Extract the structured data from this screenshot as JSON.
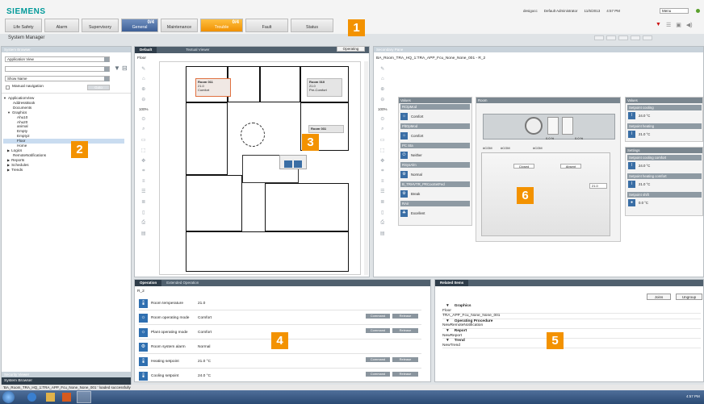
{
  "header": {
    "brand": "SIEMENS",
    "summary_bar": [
      {
        "label": "Life Safety",
        "count": "",
        "state": "normal",
        "width": 46
      },
      {
        "label": "Alarm",
        "count": "",
        "state": "normal",
        "width": 43
      },
      {
        "label": "Supervisory",
        "count": "",
        "state": "normal",
        "width": 46
      },
      {
        "label": "General",
        "count": "0/4",
        "state": "general",
        "width": 46
      },
      {
        "label": "Maintenance",
        "count": "",
        "state": "normal",
        "width": 46
      },
      {
        "label": "Trouble",
        "count": "0/4",
        "state": "trouble",
        "width": 53
      },
      {
        "label": "Fault",
        "count": "",
        "state": "normal",
        "width": 53
      },
      {
        "label": "Status",
        "count": "",
        "state": "normal",
        "width": 53
      }
    ],
    "user": "desigocc",
    "role": "Default Administrator",
    "date": "11/5/2013",
    "time": "4:57 PM",
    "menu_label": "Menu"
  },
  "app_title": "System Manager",
  "system_browser": {
    "title": "System Browser",
    "view_select": "Application View",
    "search_value": "",
    "show_select": "Show Name",
    "manual_nav_label": "Manual navigation",
    "goto_label": "Goto",
    "tree": [
      {
        "label": "ApplicationView",
        "indent": 0,
        "exp": "▼"
      },
      {
        "label": "AddressBook",
        "indent": 2,
        "exp": ""
      },
      {
        "label": "Documents",
        "indent": 2,
        "exp": ""
      },
      {
        "label": "Graphics",
        "indent": 1,
        "exp": "▼"
      },
      {
        "label": "Ahu10",
        "indent": 3,
        "exp": ""
      },
      {
        "label": "Ahu20",
        "indent": 3,
        "exp": ""
      },
      {
        "label": "animal",
        "indent": 3,
        "exp": ""
      },
      {
        "label": "Empty",
        "indent": 3,
        "exp": ""
      },
      {
        "label": "Empty2",
        "indent": 3,
        "exp": ""
      },
      {
        "label": "Floor",
        "indent": 3,
        "exp": "",
        "selected": true
      },
      {
        "label": "Home",
        "indent": 3,
        "exp": ""
      },
      {
        "label": "Logics",
        "indent": 1,
        "exp": "▶"
      },
      {
        "label": "RemoteNotifications",
        "indent": 2,
        "exp": ""
      },
      {
        "label": "Reports",
        "indent": 1,
        "exp": "▶"
      },
      {
        "label": "Schedules",
        "indent": 1,
        "exp": "▶"
      },
      {
        "label": "Trends",
        "indent": 1,
        "exp": "▶"
      }
    ],
    "footer_history": "Security Viewer",
    "footer_browser": "System Browser"
  },
  "primary_pane": {
    "tabs": [
      "Default",
      "Textual Viewer"
    ],
    "breadcrumb": "Floor",
    "operating_tab": "Operating",
    "zoom": "100%",
    "rooms": [
      {
        "name": "Room 011",
        "temp": "21.0",
        "mode": "Comfort",
        "highlight": true
      },
      {
        "name": "Room 010",
        "temp": "21.0",
        "mode": "Pre-Comfort",
        "highlight": false
      },
      {
        "name": "Room 031",
        "temp": "",
        "mode": "",
        "highlight": false
      }
    ]
  },
  "secondary_pane": {
    "title": "Secondary Pane",
    "breadcrumb": "BA_Room_TRA_HQ_1:TRA_APP_Fcu_None_None_001  -  R_2",
    "zoom": "100%",
    "values_title": "Values",
    "values": [
      {
        "group": "RCtpMod",
        "label": "Comfort",
        "icon": "☼"
      },
      {
        "group": "PltOpMod",
        "label": "Comfort",
        "icon": "☼"
      },
      {
        "group": "PC Sta",
        "label": "Neither",
        "icon": "⏻"
      },
      {
        "group": "RSysAlm",
        "label": "Normal",
        "icon": "⚙"
      },
      {
        "group": "B_TRHVTR_PRCooSetFed",
        "label": "Break",
        "icon": "⚙"
      },
      {
        "group": "RAir",
        "label": "Excellent",
        "icon": "☘"
      }
    ],
    "room_title": "Room",
    "sensors": [
      "#COM",
      "#COM",
      "#COM"
    ],
    "percents": [
      "0.0 %",
      "0.0 %"
    ],
    "window": "Closed",
    "presence": "Absent",
    "room_temp": "21.0",
    "right_values_title": "Values",
    "setpoint_cooling_label": "Setpoint cooling",
    "setpoint_cooling": "24.0 °C",
    "setpoint_heating_label": "Setpoint heating",
    "setpoint_heating": "21.0 °C",
    "settings_title": "Settings",
    "sp_cool_comfort_label": "Setpoint cooling comfort",
    "sp_cool_comfort": "24.0 °C",
    "sp_heat_comfort_label": "Setpoint heating comfort",
    "sp_heat_comfort": "21.0 °C",
    "sp_shift_label": "Setpoint shift",
    "sp_shift": "0.0 °C"
  },
  "operation": {
    "tabs": [
      "Operation",
      "Extended Operation"
    ],
    "object": "R_2",
    "command_label": "Command",
    "release_label": "Release",
    "rows": [
      {
        "label": "Room temperature",
        "value": "21.0",
        "icon": "🌡",
        "cmd": false
      },
      {
        "label": "Room operating mode",
        "value": "Comfort",
        "icon": "☼",
        "cmd": true
      },
      {
        "label": "Plant operating mode",
        "value": "Comfort",
        "icon": "☼",
        "cmd": true
      },
      {
        "label": "Room system alarm",
        "value": "Normal",
        "icon": "⚙",
        "cmd": false
      },
      {
        "label": "Heating setpoint",
        "value": "21.0 °C",
        "icon": "🌡",
        "cmd": true
      },
      {
        "label": "Cooling setpoint",
        "value": "24.0 °C",
        "icon": "🌡",
        "cmd": true
      }
    ]
  },
  "related": {
    "title": "Related Items",
    "join_label": "Joins",
    "ungroup_label": "Ungroup",
    "items": [
      {
        "label": "Graphics",
        "type": "header"
      },
      {
        "label": "Floor",
        "type": "item"
      },
      {
        "label": "TRA_APP_Fcu_None_None_001",
        "type": "item"
      },
      {
        "label": "Operating Procedure",
        "type": "header"
      },
      {
        "label": "NewRemoteNotification",
        "type": "item"
      },
      {
        "label": "Report",
        "type": "header"
      },
      {
        "label": "NewReport",
        "type": "item"
      },
      {
        "label": "Trend",
        "type": "header"
      },
      {
        "label": "NewTrend",
        "type": "item"
      }
    ]
  },
  "callouts": [
    "1",
    "2",
    "3",
    "4",
    "5",
    "6"
  ],
  "status_bar": "'BA_Room_TRA_HQ_1:TRA_APP_Fcu_None_None_001 ' loaded successfully",
  "taskbar_time": "4:57 PM"
}
